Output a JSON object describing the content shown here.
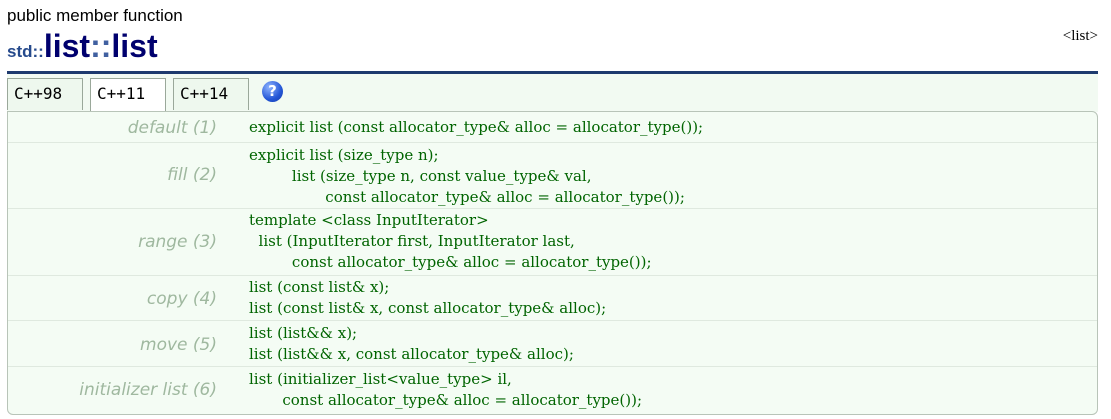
{
  "header": {
    "kind": "public member function",
    "namespace": "std::",
    "title_part1": "list",
    "title_sep": "::",
    "title_part2": "list",
    "link": "<list>"
  },
  "tabs": [
    {
      "label": "C++98"
    },
    {
      "label": "C++11"
    },
    {
      "label": "C++14"
    }
  ],
  "active_tab": "C++11",
  "help_icon": "?",
  "rows": [
    {
      "label": "default (1)",
      "code": "explicit list (const allocator_type& alloc = allocator_type());"
    },
    {
      "label": "fill (2)",
      "code": "explicit list (size_type n);\n         list (size_type n, const value_type& val,\n                const allocator_type& alloc = allocator_type());"
    },
    {
      "label": "range (3)",
      "code": "template <class InputIterator>\n  list (InputIterator first, InputIterator last,\n         const allocator_type& alloc = allocator_type());"
    },
    {
      "label": "copy (4)",
      "code": "list (const list& x);\nlist (const list& x, const allocator_type& alloc);"
    },
    {
      "label": "move (5)",
      "code": "list (list&& x);\nlist (list&& x, const allocator_type& alloc);"
    },
    {
      "label": "initializer list (6)",
      "code": "list (initializer_list<value_type> il,\n       const allocator_type& alloc = allocator_type());"
    }
  ],
  "colors": {
    "title": "#00006e",
    "code": "#006400",
    "label": "#9fb89f",
    "panel_bg": "#f4fcf4"
  }
}
